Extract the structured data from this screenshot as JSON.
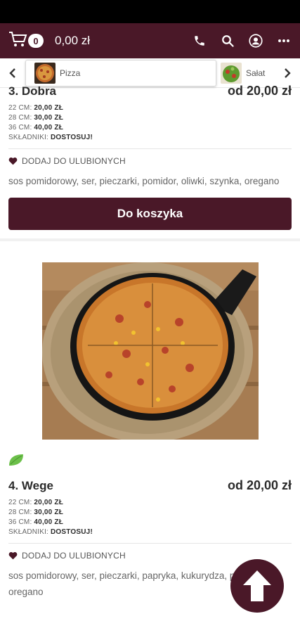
{
  "header": {
    "cart_count": "0",
    "cart_total": "0,00 zł",
    "icons": [
      "cart-icon",
      "phone-icon",
      "search-icon",
      "user-icon",
      "more-icon"
    ]
  },
  "categories": {
    "items": [
      {
        "label": "Pizza"
      },
      {
        "label": "Sałat"
      }
    ]
  },
  "products": [
    {
      "name": "3. Dobra",
      "price": "od 20,00 zł",
      "sizes": [
        {
          "label": "22 CM:",
          "value": "20,00 ZŁ"
        },
        {
          "label": "28 CM:",
          "value": "30,00 ZŁ"
        },
        {
          "label": "36 CM:",
          "value": "40,00 ZŁ"
        }
      ],
      "ingredients_label": "SKŁADNIKI:",
      "ingredients_link": "DOSTOSUJ!",
      "favorite_label": "DODAJ DO ULUBIONYCH",
      "description": "sos pomidorowy, ser, pieczarki, pomidor, oliwki, szynka, oregano",
      "button_label": "Do koszyka"
    },
    {
      "name": "4. Wege",
      "price": "od 20,00 zł",
      "sizes": [
        {
          "label": "22 CM:",
          "value": "20,00 ZŁ"
        },
        {
          "label": "28 CM:",
          "value": "30,00 ZŁ"
        },
        {
          "label": "36 CM:",
          "value": "40,00 ZŁ"
        }
      ],
      "ingredients_label": "SKŁADNIKI:",
      "ingredients_link": "DOSTOSUJ!",
      "favorite_label": "DODAJ DO ULUBIONYCH",
      "description": "sos pomidorowy, ser, pieczarki, papryka, kukurydza, pomidor, oregano"
    }
  ],
  "colors": {
    "brand": "#4a1828",
    "veg": "#6cc04a"
  }
}
